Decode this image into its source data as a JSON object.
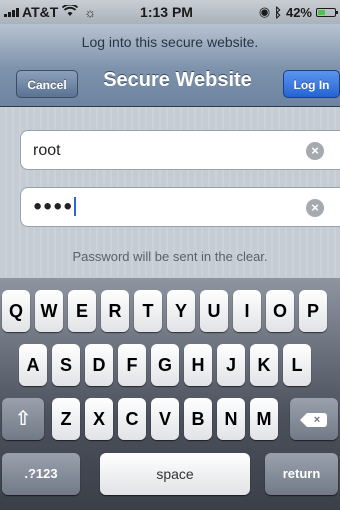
{
  "status_bar": {
    "carrier": "AT&T",
    "time": "1:13 PM",
    "battery": "42%",
    "battery_level": 0.42,
    "icons": [
      "signal-bars-icon",
      "wifi-icon",
      "activity-spinner-icon",
      "lock-icon",
      "bluetooth-icon",
      "battery-icon"
    ]
  },
  "nav": {
    "prompt": "Log into this secure website.",
    "title": "Secure Website",
    "cancel_label": "Cancel",
    "login_label": "Log In"
  },
  "form": {
    "username_value": "root",
    "password_value": "●●●●",
    "warning": "Password will be sent in the clear."
  },
  "keyboard": {
    "row1": [
      "Q",
      "W",
      "E",
      "R",
      "T",
      "Y",
      "U",
      "I",
      "O",
      "P"
    ],
    "row2": [
      "A",
      "S",
      "D",
      "F",
      "G",
      "H",
      "J",
      "K",
      "L"
    ],
    "row3": [
      "Z",
      "X",
      "C",
      "V",
      "B",
      "N",
      "M"
    ],
    "numbers_label": ".?123",
    "space_label": "space",
    "return_label": "return"
  },
  "colors": {
    "nav_blue": "#6d84a0",
    "login_blue": "#2563d3",
    "caret": "#2b67d8"
  }
}
